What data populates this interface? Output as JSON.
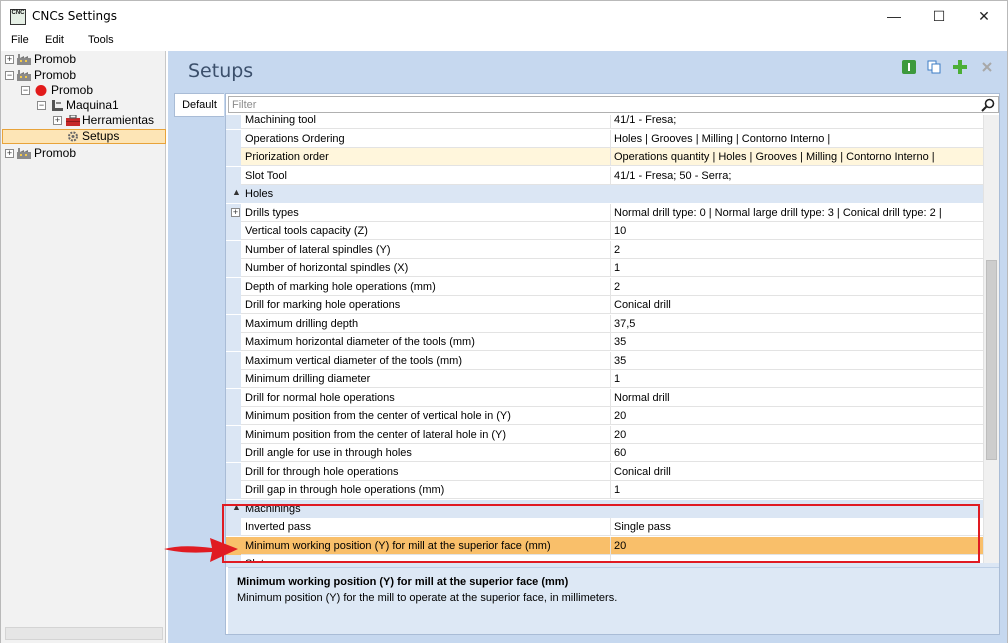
{
  "window": {
    "title": "CNCs Settings",
    "app_icon_text": "CNC",
    "minimize_glyph": "—",
    "maximize_glyph": "☐",
    "close_glyph": "✕"
  },
  "menu": [
    "File",
    "Edit",
    "Tools"
  ],
  "tree": [
    {
      "label": "Promob",
      "expander": "+",
      "icon": "factory-icon"
    },
    {
      "label": "Promob",
      "expander": "−",
      "icon": "factory-icon"
    },
    {
      "label": "Promob",
      "expander": "−",
      "icon": "red-dot-icon"
    },
    {
      "label": "Maquina1",
      "expander": "−",
      "icon": "machine-icon"
    },
    {
      "label": "Herramientas",
      "expander": "+",
      "icon": "toolbox-icon"
    },
    {
      "label": "Setups",
      "expander": "",
      "icon": "gear-icon"
    },
    {
      "label": "Promob",
      "expander": "+",
      "icon": "factory-icon"
    }
  ],
  "setups": {
    "title": "Setups",
    "tab": "Default",
    "filter_placeholder": "Filter",
    "toolbar_icons": [
      "info-icon",
      "copy-icon",
      "add-icon",
      "delete-icon"
    ]
  },
  "grid": {
    "rows": [
      {
        "type": "prop",
        "name": "Machining tool",
        "value": "41/1 - Fresa;"
      },
      {
        "type": "prop",
        "name": "Operations Ordering",
        "value": "Holes | Grooves | Milling | Contorno Interno |"
      },
      {
        "type": "prop",
        "name": "Priorization order",
        "value": "Operations quantity | Holes | Grooves | Milling | Contorno Interno |",
        "style": "yellow"
      },
      {
        "type": "prop",
        "name": "Slot Tool",
        "value": "41/1 - Fresa; 50 - Serra;"
      },
      {
        "type": "cat",
        "name": "Holes"
      },
      {
        "type": "prop",
        "name": "Drills types",
        "value": "Normal drill type: 0  |  Normal large drill type: 3  |  Conical drill type: 2  |",
        "expander": "+"
      },
      {
        "type": "prop",
        "name": "Vertical tools capacity (Z)",
        "value": "10"
      },
      {
        "type": "prop",
        "name": "Number of lateral spindles (Y)",
        "value": "2"
      },
      {
        "type": "prop",
        "name": "Number of horizontal spindles (X)",
        "value": "1"
      },
      {
        "type": "prop",
        "name": "Depth of marking hole operations (mm)",
        "value": "2"
      },
      {
        "type": "prop",
        "name": "Drill for marking hole operations",
        "value": "Conical drill"
      },
      {
        "type": "prop",
        "name": "Maximum drilling depth",
        "value": "37,5"
      },
      {
        "type": "prop",
        "name": "Maximum horizontal diameter of the tools (mm)",
        "value": "35"
      },
      {
        "type": "prop",
        "name": "Maximum vertical diameter of the tools (mm)",
        "value": "35"
      },
      {
        "type": "prop",
        "name": "Minimum drilling diameter",
        "value": "1"
      },
      {
        "type": "prop",
        "name": "Drill for normal hole operations",
        "value": "Normal drill"
      },
      {
        "type": "prop",
        "name": "Minimum position from the center of vertical hole in  (Y)",
        "value": "20"
      },
      {
        "type": "prop",
        "name": "Minimum position from the center of lateral hole in (Y)",
        "value": "20"
      },
      {
        "type": "prop",
        "name": "Drill angle for use in through holes",
        "value": "60"
      },
      {
        "type": "prop",
        "name": "Drill for through hole operations",
        "value": "Conical drill"
      },
      {
        "type": "prop",
        "name": "Drill gap in through hole operations (mm)",
        "value": "1"
      },
      {
        "type": "cat",
        "name": "Machinings"
      },
      {
        "type": "prop",
        "name": "Inverted pass",
        "value": "Single pass"
      },
      {
        "type": "prop",
        "name": "Minimum working position (Y) for mill at the superior face (mm)",
        "value": "20",
        "style": "orange"
      },
      {
        "type": "prop",
        "name": "Slot",
        "value": ""
      }
    ]
  },
  "description": {
    "title": "Minimum working position (Y) for mill at the superior face (mm)",
    "text": "Minimum position (Y) for the mill to operate at the superior face, in millimeters."
  },
  "colors": {
    "selected_row": "#f9bf6a",
    "highlight_border": "#e01b22",
    "category_band": "#dbe6f4",
    "pane_background": "#c6d8ef"
  }
}
